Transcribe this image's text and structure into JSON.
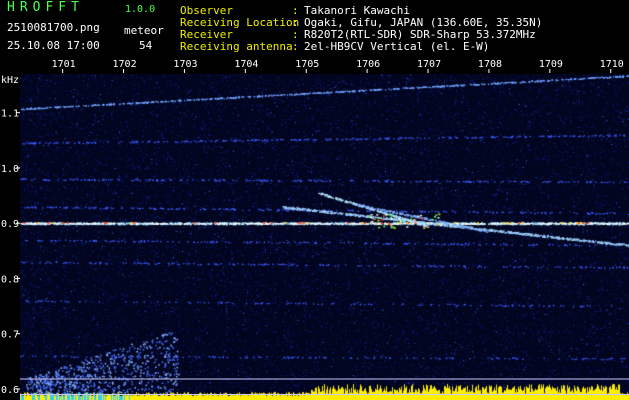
{
  "header": {
    "app_name": "HROFFT",
    "version": "1.0.0",
    "file_name": "2510081700.png",
    "date_time": "25.10.08 17:00",
    "meteor_label": "meteor",
    "meteor_count": "54"
  },
  "info": [
    {
      "key": "Observer",
      "sep": ":",
      "value": "Takanori Kawachi"
    },
    {
      "key": "Receiving Location",
      "sep": ":",
      "value": "Ogaki, Gifu, JAPAN (136.60E, 35.35N)"
    },
    {
      "key": "Receiver",
      "sep": ":",
      "value": "R820T2(RTL-SDR) SDR-Sharp 53.372MHz"
    },
    {
      "key": "Receiving antenna",
      "sep": ":",
      "value": "2el-HB9CV Vertical (el. E-W)"
    }
  ],
  "chart_data": {
    "type": "heatmap",
    "ylabel": "kHz",
    "x_ticks": [
      "1701",
      "1702",
      "1703",
      "1704",
      "1705",
      "1706",
      "1707",
      "1708",
      "1709",
      "1710"
    ],
    "y_ticks": [
      "1.1",
      "1.0",
      "0.9",
      "0.8",
      "0.7",
      "0.6"
    ],
    "xlim": [
      1700.3,
      1710.3
    ],
    "ylim": [
      0.58,
      1.17
    ],
    "carrier_khz": 0.9,
    "marker_lines_khz": [
      0.618,
      0.59
    ],
    "colors": {
      "background": "#01051f",
      "noise": "#1a2aa0",
      "signal": "#ffffff",
      "hot": "#ff3030",
      "level_bar": "#ffee00"
    }
  }
}
